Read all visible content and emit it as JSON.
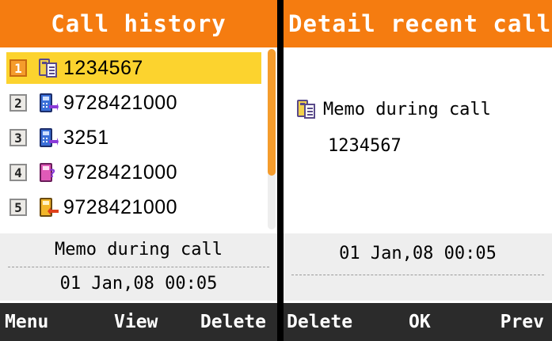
{
  "left_screen": {
    "title": "Call history",
    "calls": [
      {
        "index": "1",
        "number": "1234567",
        "icon": "memo-call-icon",
        "selected": true
      },
      {
        "index": "2",
        "number": "9728421000",
        "icon": "outgoing-call-icon",
        "selected": false
      },
      {
        "index": "3",
        "number": "3251",
        "icon": "outgoing-call-icon",
        "selected": false
      },
      {
        "index": "4",
        "number": "9728421000",
        "icon": "missed-call-icon",
        "selected": false
      },
      {
        "index": "5",
        "number": "9728421000",
        "icon": "received-call-icon",
        "selected": false
      }
    ],
    "info_type": "Memo during call",
    "info_datetime": "01 Jan,08 00:05",
    "softkeys": {
      "left": "Menu",
      "center": "View",
      "right": "Delete"
    }
  },
  "right_screen": {
    "title": "Detail recent call",
    "memo_label": "Memo during call",
    "memo_icon": "memo-call-icon",
    "number": "1234567",
    "datetime": "01 Jan,08 00:05",
    "softkeys": {
      "left": "Delete",
      "center": "OK",
      "right": "Prev"
    }
  },
  "colors": {
    "header": "#f57c10",
    "selected_row": "#fcd32e",
    "softkey_bar": "#2b2b2b",
    "info_band": "#eeeeee"
  }
}
